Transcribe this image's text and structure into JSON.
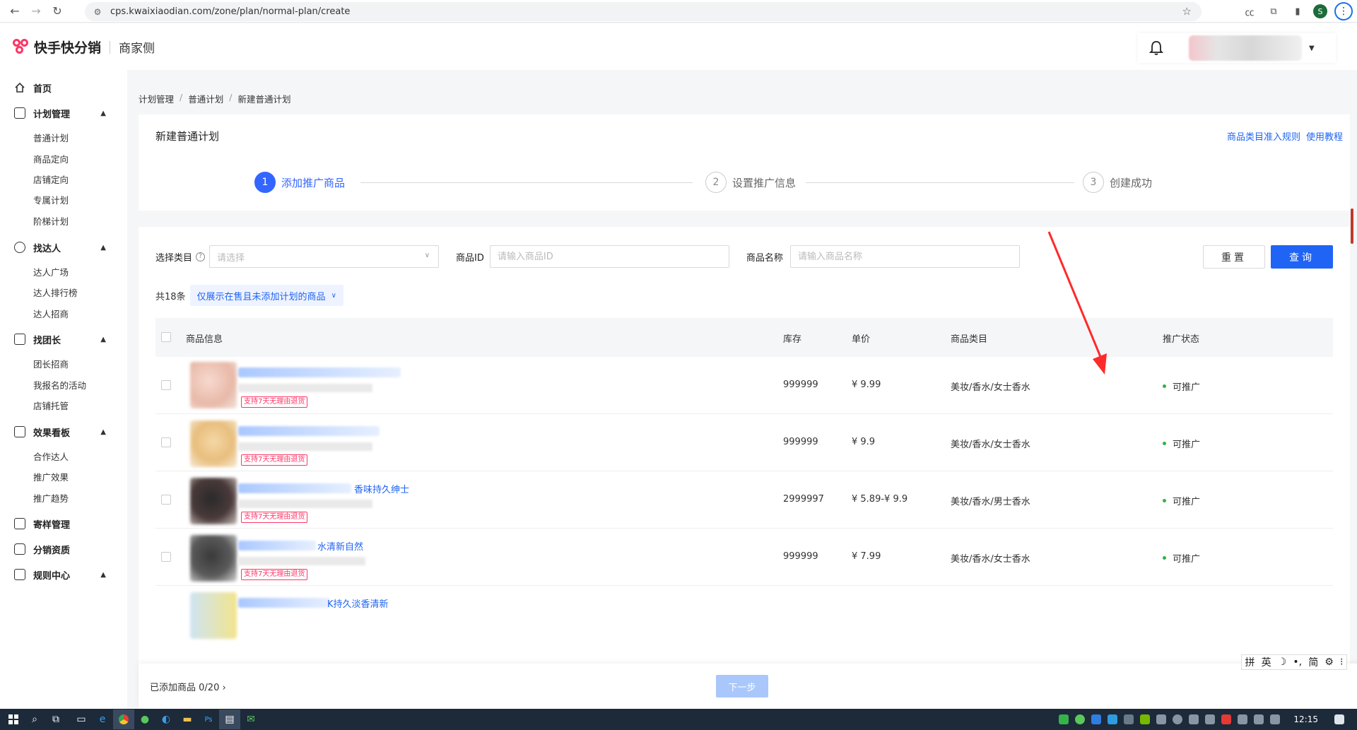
{
  "browser": {
    "url": "cps.kwaixiaodian.com/zone/plan/normal-plan/create",
    "profile_initial": "S"
  },
  "header": {
    "logo_text": "快手快分销",
    "sub_title": "商家侧"
  },
  "sidebar": {
    "home": "首页",
    "groups": [
      {
        "label": "计划管理",
        "items": [
          "普通计划",
          "商品定向",
          "店铺定向",
          "专属计划",
          "阶梯计划"
        ]
      },
      {
        "label": "找达人",
        "items": [
          "达人广场",
          "达人排行榜",
          "达人招商"
        ]
      },
      {
        "label": "找团长",
        "items": [
          "团长招商",
          "我报名的活动",
          "店铺托管"
        ]
      },
      {
        "label": "效果看板",
        "items": [
          "合作达人",
          "推广效果",
          "推广趋势"
        ]
      }
    ],
    "bottom": [
      "寄样管理",
      "分销资质",
      "规则中心"
    ]
  },
  "breadcrumb": [
    "计划管理",
    "普通计划",
    "新建普通计划"
  ],
  "page": {
    "title": "新建普通计划",
    "links": [
      "商品类目准入规则",
      "使用教程"
    ]
  },
  "steps": [
    {
      "num": "1",
      "label": "添加推广商品"
    },
    {
      "num": "2",
      "label": "设置推广信息"
    },
    {
      "num": "3",
      "label": "创建成功"
    }
  ],
  "filters": {
    "category_label": "选择类目",
    "category_placeholder": "请选择",
    "id_label": "商品ID",
    "id_placeholder": "请输入商品ID",
    "name_label": "商品名称",
    "name_placeholder": "请输入商品名称",
    "reset": "重置",
    "query": "查询"
  },
  "list": {
    "count_text": "共18条",
    "filter_tag": "仅展示在售且未添加计划的商品"
  },
  "table": {
    "headers": [
      "商品信息",
      "库存",
      "单价",
      "商品类目",
      "推广状态"
    ],
    "rows": [
      {
        "title_tail": "",
        "tag": "支持7天无理由退货",
        "stock": "999999",
        "price": "¥ 9.99",
        "category": "美妆/香水/女士香水",
        "status": "可推广"
      },
      {
        "title_tail": "",
        "tag": "支持7天无理由退货",
        "stock": "999999",
        "price": "¥ 9.9",
        "category": "美妆/香水/女士香水",
        "status": "可推广"
      },
      {
        "title_tail": "香味持久绅士",
        "tag": "支持7天无理由退货",
        "stock": "2999997",
        "price": "¥ 5.89-¥ 9.9",
        "category": "美妆/香水/男士香水",
        "status": "可推广"
      },
      {
        "title_tail": "水清新自然",
        "tag": "支持7天无理由退货",
        "stock": "999999",
        "price": "¥ 7.99",
        "category": "美妆/香水/女士香水",
        "status": "可推广"
      },
      {
        "title_tail": "K持久淡香清新",
        "tag": "",
        "stock": "",
        "price": "",
        "category": "",
        "status": ""
      }
    ]
  },
  "bottom_bar": {
    "added_label": "已添加商品",
    "added_count": "0/20",
    "next": "下一步"
  },
  "ime": [
    "拼",
    "英",
    "简"
  ],
  "taskbar": {
    "time": "12:15"
  },
  "colors": {
    "primary": "#1f64f4",
    "step_active": "#3366ff",
    "tag_pink": "#fe3666",
    "status_green": "#2fb344",
    "annotation_arrow": "#ff2a2a"
  }
}
